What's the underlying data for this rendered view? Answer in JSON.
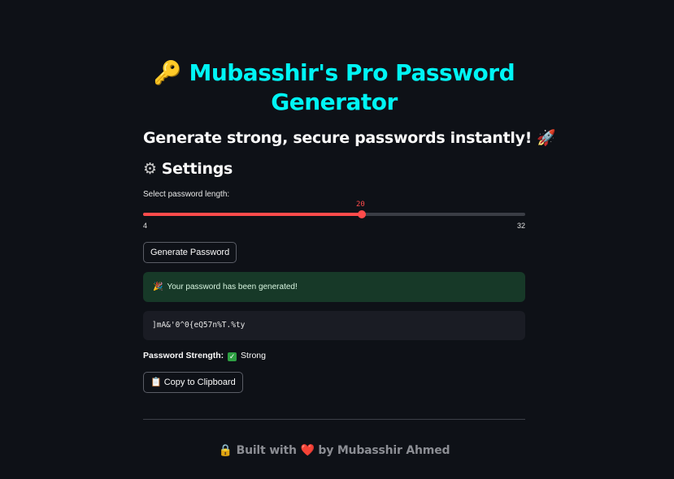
{
  "header": {
    "title_icon": "🔑",
    "title_line1": "Mubasshir's Pro Password",
    "title_line2": "Generator",
    "title_color": "#00f5f5",
    "subtitle": "Generate strong, secure passwords instantly!",
    "subtitle_icon": "🚀"
  },
  "settings": {
    "icon": "gear-icon",
    "heading": "Settings",
    "slider_label": "Select password length:",
    "slider_value": "20",
    "slider_min": "4",
    "slider_max": "32",
    "accent_color": "#ff4b4b"
  },
  "actions": {
    "generate_label": "Generate Password",
    "copy_label": "Copy to Clipboard",
    "copy_icon": "clipboard-icon"
  },
  "result": {
    "success_icon": "party-popper-icon",
    "success_message": "Your password has been generated!",
    "password": "]mA&'0^0{eQ57n%T.%ty",
    "strength_label": "Password Strength:",
    "strength_value": "Strong",
    "strength_icon": "check-mark-icon"
  },
  "footer": {
    "lock_icon": "🔒",
    "text_prefix": "Built with",
    "heart_icon": "❤️",
    "text_suffix": "by Mubasshir Ahmed"
  }
}
